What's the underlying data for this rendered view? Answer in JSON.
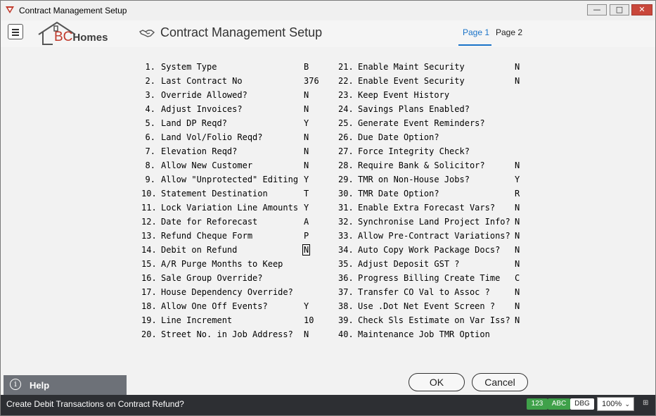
{
  "window": {
    "title": "Contract Management Setup",
    "minimize_glyph": "—",
    "maximize_glyph": "□",
    "close_glyph": "✕"
  },
  "header": {
    "logo_bc": "BC",
    "logo_homes": "Homes",
    "title": "Contract Management Setup",
    "tabs": [
      {
        "label": "Page 1",
        "active": true
      },
      {
        "label": "Page 2",
        "active": false
      }
    ]
  },
  "fields_left": [
    {
      "num": "1.",
      "label": "System Type",
      "value": "B"
    },
    {
      "num": "2.",
      "label": "Last Contract No",
      "value": "376"
    },
    {
      "num": "3.",
      "label": "Override Allowed?",
      "value": "N"
    },
    {
      "num": "4.",
      "label": "Adjust Invoices?",
      "value": "N"
    },
    {
      "num": "5.",
      "label": "Land DP Reqd?",
      "value": "Y"
    },
    {
      "num": "6.",
      "label": "Land Vol/Folio Reqd?",
      "value": "N"
    },
    {
      "num": "7.",
      "label": "Elevation Reqd?",
      "value": "N"
    },
    {
      "num": "8.",
      "label": "Allow New Customer",
      "value": "N"
    },
    {
      "num": "9.",
      "label": "Allow \"Unprotected\" Editing",
      "value": "Y"
    },
    {
      "num": "10.",
      "label": "Statement Destination",
      "value": "T"
    },
    {
      "num": "11.",
      "label": "Lock Variation Line Amounts",
      "value": "Y"
    },
    {
      "num": "12.",
      "label": "Date for Reforecast",
      "value": "A"
    },
    {
      "num": "13.",
      "label": "Refund Cheque Form",
      "value": "P"
    },
    {
      "num": "14.",
      "label": "Debit on Refund",
      "value": "N"
    },
    {
      "num": "15.",
      "label": "A/R Purge Months to Keep",
      "value": ""
    },
    {
      "num": "16.",
      "label": "Sale Group Override?",
      "value": ""
    },
    {
      "num": "17.",
      "label": "House Dependency Override?",
      "value": ""
    },
    {
      "num": "18.",
      "label": "Allow One Off Events?",
      "value": "Y"
    },
    {
      "num": "19.",
      "label": "Line Increment",
      "value": "10"
    },
    {
      "num": "20.",
      "label": "Street No. in Job Address?",
      "value": "N"
    }
  ],
  "fields_right": [
    {
      "num": "21.",
      "label": "Enable Maint Security",
      "value": "N"
    },
    {
      "num": "22.",
      "label": "Enable Event Security",
      "value": "N"
    },
    {
      "num": "23.",
      "label": "Keep Event History",
      "value": ""
    },
    {
      "num": "24.",
      "label": "Savings Plans Enabled?",
      "value": ""
    },
    {
      "num": "25.",
      "label": "Generate Event Reminders?",
      "value": ""
    },
    {
      "num": "26.",
      "label": "Due Date Option?",
      "value": ""
    },
    {
      "num": "27.",
      "label": "Force Integrity Check?",
      "value": ""
    },
    {
      "num": "28.",
      "label": "Require Bank & Solicitor?",
      "value": "N"
    },
    {
      "num": "29.",
      "label": "TMR on Non-House Jobs?",
      "value": "Y"
    },
    {
      "num": "30.",
      "label": "TMR Date Option?",
      "value": "R"
    },
    {
      "num": "31.",
      "label": "Enable Extra Forecast Vars?",
      "value": "N"
    },
    {
      "num": "32.",
      "label": "Synchronise Land Project Info?",
      "value": "N"
    },
    {
      "num": "33.",
      "label": "Allow Pre-Contract Variations?",
      "value": "N"
    },
    {
      "num": "34.",
      "label": "Auto Copy Work Package Docs?",
      "value": "N"
    },
    {
      "num": "35.",
      "label": "Adjust Deposit GST ?",
      "value": "N"
    },
    {
      "num": "36.",
      "label": "Progress Billing Create Time",
      "value": "C"
    },
    {
      "num": "37.",
      "label": "Transfer CO Val to Assoc ?",
      "value": "N"
    },
    {
      "num": "38.",
      "label": "Use .Dot Net Event Screen ?",
      "value": "N"
    },
    {
      "num": "39.",
      "label": "Check Sls Estimate on Var Iss?",
      "value": "N"
    },
    {
      "num": "40.",
      "label": "Maintenance Job TMR Option",
      "value": ""
    }
  ],
  "help": {
    "label": "Help",
    "icon_glyph": "i"
  },
  "buttons": {
    "ok": "OK",
    "cancel": "Cancel"
  },
  "status": {
    "message": "Create Debit Transactions on Contract Refund?",
    "badges": [
      "123",
      "ABC",
      "DBG"
    ],
    "zoom": "100%",
    "zoom_chevron": "⌄",
    "grip_glyph": "⊞"
  }
}
